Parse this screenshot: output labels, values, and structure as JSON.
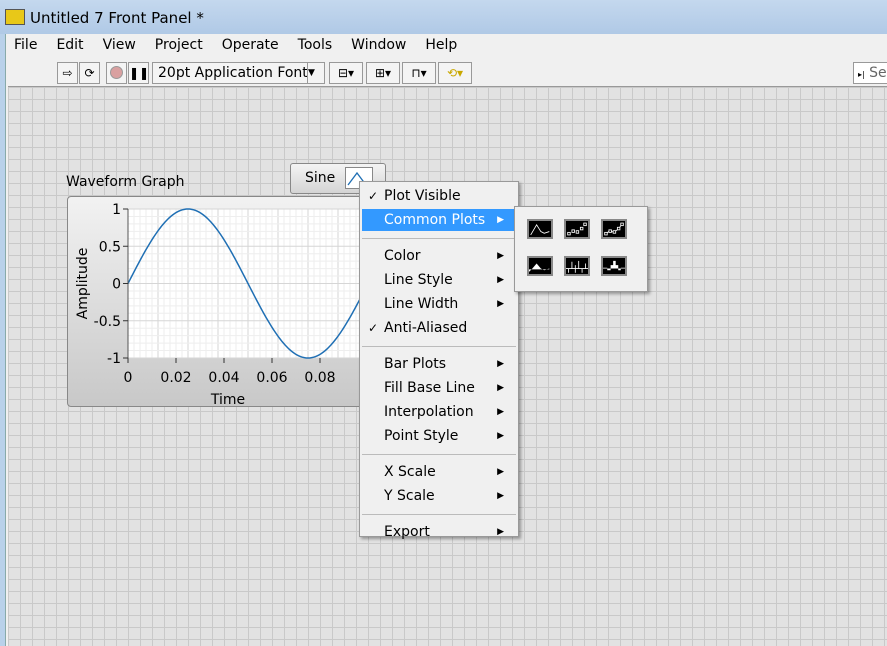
{
  "window": {
    "title": "Untitled 7 Front Panel *"
  },
  "menu": [
    "File",
    "Edit",
    "View",
    "Project",
    "Operate",
    "Tools",
    "Window",
    "Help"
  ],
  "toolbar": {
    "font": "20pt Application Font",
    "search": "Se"
  },
  "graph": {
    "label": "Waveform Graph",
    "xlabel": "Time",
    "ylabel": "Amplitude",
    "plot_name": "Sine",
    "line_color": "#1f6fb4"
  },
  "chart_data": {
    "type": "line",
    "xlabel": "Time",
    "ylabel": "Amplitude",
    "xlim": [
      0,
      0.1
    ],
    "ylim": [
      -1,
      1
    ],
    "xticks": [
      "0",
      "0.02",
      "0.04",
      "0.06",
      "0.08"
    ],
    "yticks": [
      "1",
      "0.5",
      "0",
      "-0.5",
      "-1"
    ],
    "grid": true,
    "series": [
      {
        "name": "Sine",
        "function": "sin(2*pi*10*t)",
        "x_range": [
          0,
          0.1
        ]
      }
    ]
  },
  "context_menu": {
    "items": [
      {
        "label": "Plot Visible",
        "checked": true
      },
      {
        "label": "Common Plots",
        "submenu": true,
        "highlighted": true
      },
      {
        "label": "Color",
        "submenu": true
      },
      {
        "label": "Line Style",
        "submenu": true
      },
      {
        "label": "Line Width",
        "submenu": true
      },
      {
        "label": "Anti-Aliased",
        "checked": true
      },
      {
        "label": "Bar Plots",
        "submenu": true
      },
      {
        "label": "Fill Base Line",
        "submenu": true
      },
      {
        "label": "Interpolation",
        "submenu": true
      },
      {
        "label": "Point Style",
        "submenu": true
      },
      {
        "label": "X Scale",
        "submenu": true
      },
      {
        "label": "Y Scale",
        "submenu": true
      },
      {
        "label": "Export",
        "submenu": true
      }
    ]
  },
  "common_plots": [
    "line-plot-icon",
    "scatter-plot-icon",
    "line-points-plot-icon",
    "fill-plot-icon",
    "bar-plot-icon",
    "step-bar-plot-icon"
  ],
  "glyphs": {
    "check": "✓",
    "arrow": "▶"
  }
}
